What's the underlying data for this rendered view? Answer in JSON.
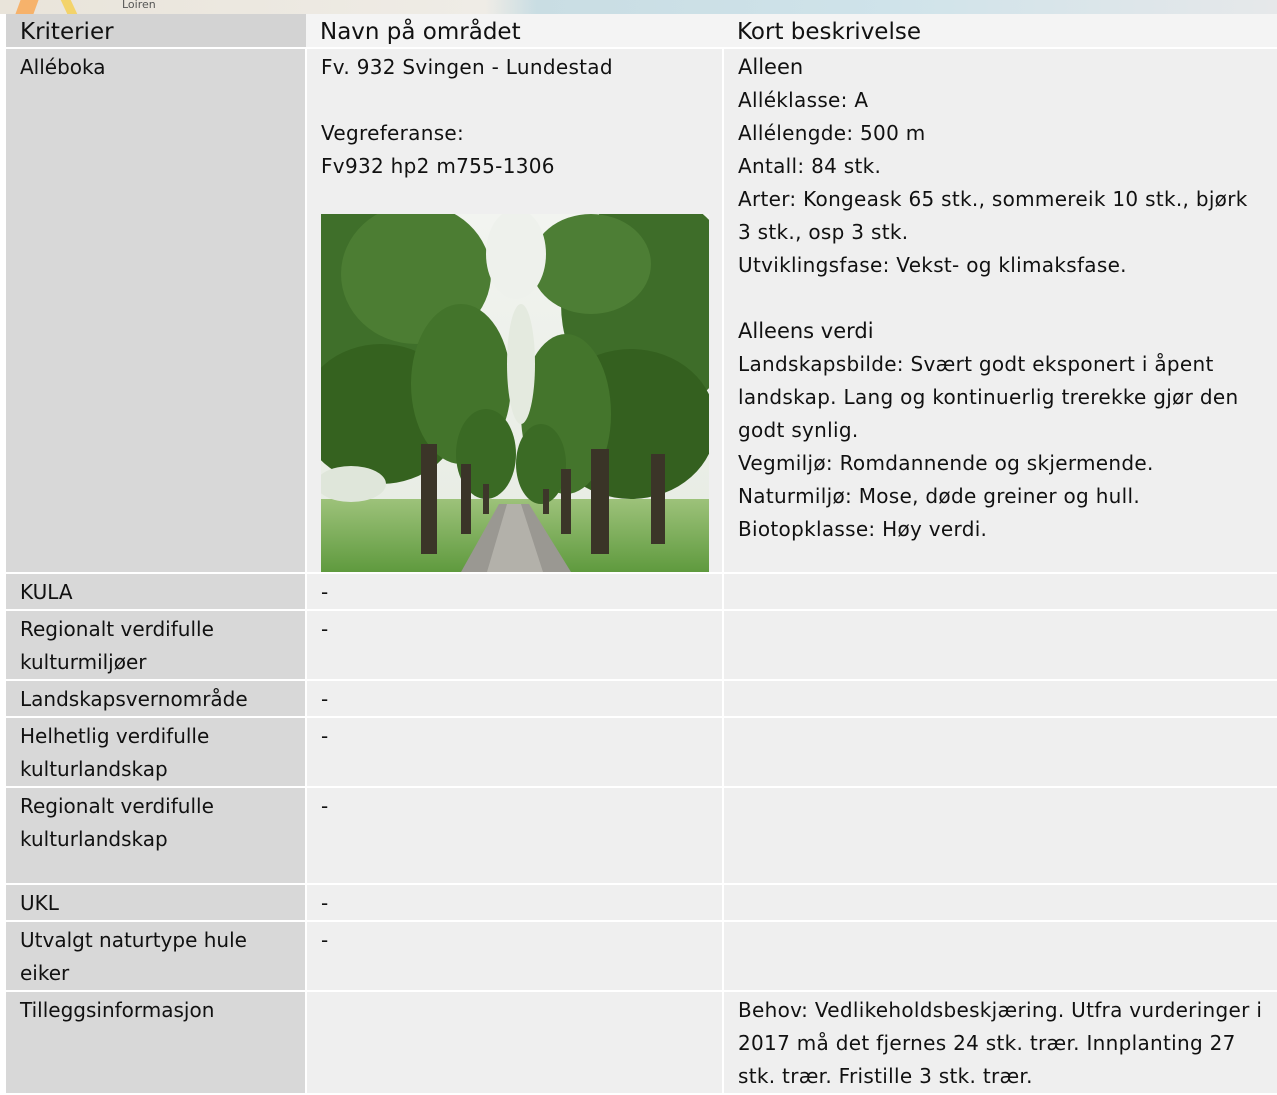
{
  "header": {
    "criteria": "Kriterier",
    "area_name": "Navn på området",
    "description": "Kort beskrivelse"
  },
  "map_label": "Loiren",
  "rows": [
    {
      "criterion": "Alléboka",
      "area": {
        "name": "Fv. 932 Svingen - Lundestad",
        "ref_label": "Vegreferanse:",
        "ref_value": "Fv932 hp2 m755-1306"
      },
      "description": {
        "heading1": "Alleen",
        "lines1": [
          "Alléklasse: A",
          "Allélengde: 500 m",
          "Antall: 84 stk.",
          "Arter: Kongeask 65 stk., sommereik 10 stk., bjørk 3 stk., osp 3 stk.",
          "Utviklingsfase: Vekst- og klimaksfase."
        ],
        "heading2": "Alleens verdi",
        "lines2": [
          "Landskapsbilde: Svært godt eksponert i åpent landskap. Lang og kontinuerlig trerekke gjør den godt synlig.",
          "Vegmiljø: Romdannende og skjermende.",
          "Naturmiljø: Mose, døde greiner og hull.",
          "Biotopklasse: Høy verdi."
        ]
      }
    },
    {
      "criterion": "KULA",
      "area": "-",
      "description": ""
    },
    {
      "criterion": "Regionalt verdifulle kulturmiljøer",
      "area": "-",
      "description": ""
    },
    {
      "criterion": "Landskapsvernområde",
      "area": "-",
      "description": ""
    },
    {
      "criterion": "Helhetlig verdifulle kulturlandskap",
      "area": "-",
      "description": ""
    },
    {
      "criterion": "Regionalt verdifulle kulturlandskap",
      "area": "-",
      "description": ""
    },
    {
      "criterion": "UKL",
      "area": "-",
      "description": ""
    },
    {
      "criterion": "Utvalgt naturtype hule eiker",
      "area": "-",
      "description": ""
    },
    {
      "criterion": "Tilleggsinformasjon",
      "area": "",
      "description": "Behov: Vedlikeholdsbeskjæring. Utfra vurderinger i 2017 må det fjernes 24 stk. trær. Innplanting 27 stk. trær. Fristille 3 stk. trær."
    }
  ]
}
